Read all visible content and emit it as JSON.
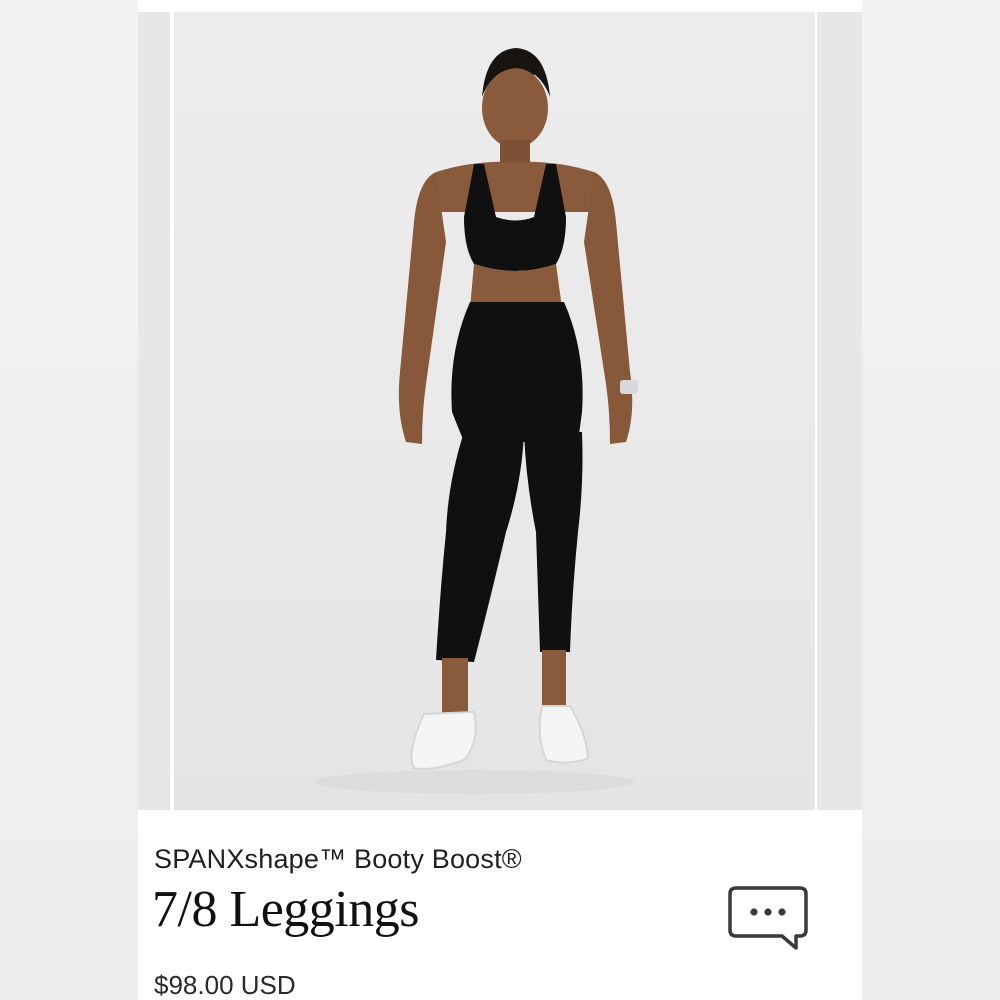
{
  "product": {
    "brand": "SPANXshape™ Booty Boost®",
    "title": "7/8 Leggings",
    "price": "$98.00 USD"
  },
  "image": {
    "alt": "Model wearing black sports bra and black 7/8 leggings with white sneakers"
  },
  "icons": {
    "chat": "chat-bubble-icon"
  },
  "colors": {
    "background": "#efefef",
    "card": "#ffffff",
    "photo_bg": "#eaeaea",
    "garment": "#101010",
    "text": "#111111"
  }
}
